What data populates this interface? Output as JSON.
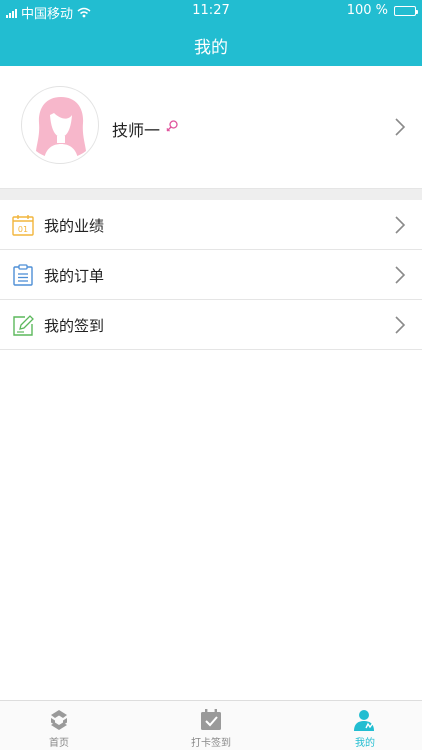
{
  "status_bar": {
    "carrier": "中国移动",
    "time": "11:27",
    "battery": "100 %"
  },
  "header": {
    "title": "我的"
  },
  "profile": {
    "name": "技师一"
  },
  "menu": {
    "items": [
      {
        "label": "我的业绩",
        "icon": "calendar-icon"
      },
      {
        "label": "我的订单",
        "icon": "clipboard-icon"
      },
      {
        "label": "我的签到",
        "icon": "edit-icon"
      }
    ]
  },
  "tabbar": {
    "items": [
      {
        "label": "首页",
        "icon": "home-icon",
        "active": false
      },
      {
        "label": "打卡签到",
        "icon": "checkin-icon",
        "active": false
      },
      {
        "label": "我的",
        "icon": "user-icon",
        "active": true
      }
    ]
  },
  "colors": {
    "accent": "#22bdd1",
    "female": "#e0539c",
    "calendar_icon": "#f2b53c",
    "clipboard_icon": "#4e8fd6",
    "edit_icon": "#5cb85c"
  }
}
